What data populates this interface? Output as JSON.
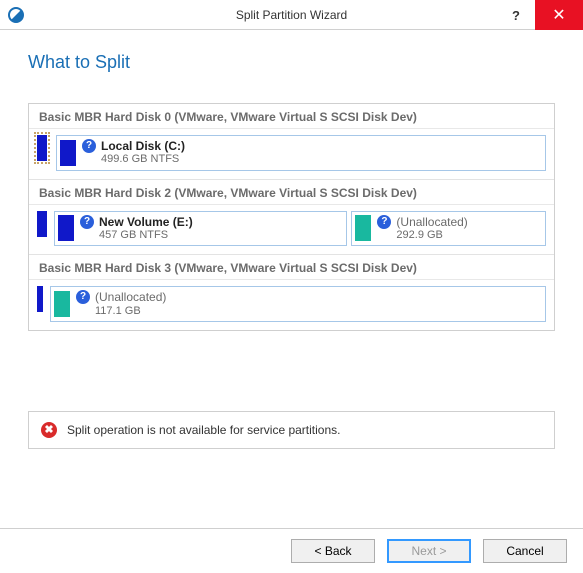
{
  "window": {
    "title": "Split Partition Wizard"
  },
  "heading": "What to Split",
  "disks": [
    {
      "header": "Basic MBR Hard Disk 0 (VMware, VMware Virtual S SCSI Disk Dev)",
      "partitions": [
        {
          "name": "Local Disk (C:)",
          "size": "499.6 GB NTFS",
          "color": "blue",
          "selected": true,
          "unalloc": false
        }
      ]
    },
    {
      "header": "Basic MBR Hard Disk 2 (VMware, VMware Virtual S SCSI Disk Dev)",
      "partitions": [
        {
          "name": "New Volume (E:)",
          "size": "457 GB NTFS",
          "color": "blue",
          "selected": false,
          "unalloc": false
        },
        {
          "name": "(Unallocated)",
          "size": "292.9 GB",
          "color": "teal",
          "selected": false,
          "unalloc": true
        }
      ]
    },
    {
      "header": "Basic MBR Hard Disk 3 (VMware, VMware Virtual S SCSI Disk Dev)",
      "partitions": [
        {
          "name": "(Unallocated)",
          "size": "117.1 GB",
          "color": "teal",
          "selected": false,
          "unalloc": true
        }
      ]
    }
  ],
  "warning": "Split operation is not available for service partitions.",
  "buttons": {
    "back": "< Back",
    "next": "Next >",
    "cancel": "Cancel"
  }
}
